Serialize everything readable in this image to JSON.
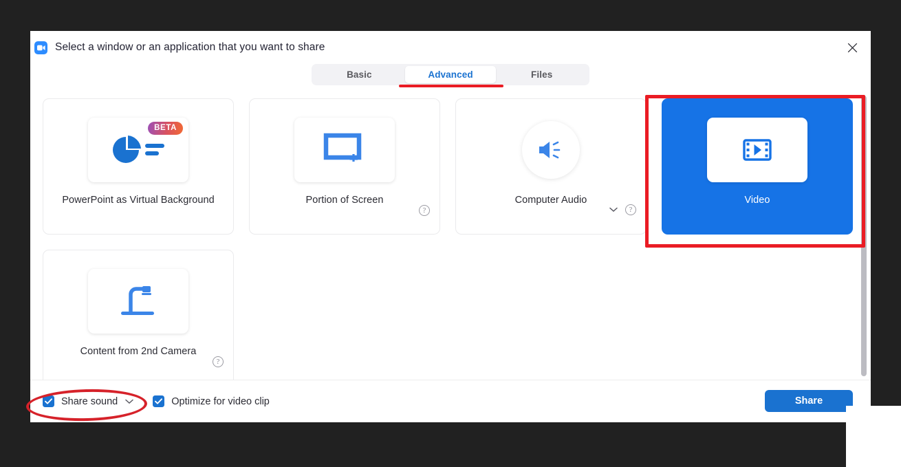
{
  "window": {
    "title": "Select a window or an application that you want to share",
    "logo_icon": "zoom-video-logo-icon",
    "close_icon": "close-icon"
  },
  "tabs": {
    "items": [
      {
        "label": "Basic",
        "active": false
      },
      {
        "label": "Advanced",
        "active": true
      },
      {
        "label": "Files",
        "active": false
      }
    ],
    "active_label": "Advanced"
  },
  "share_options": [
    {
      "label": "PowerPoint as Virtual Background",
      "icon": "pie-chart-slide-icon",
      "badge": "BETA",
      "selected": false,
      "has_help": false,
      "has_chevron": false
    },
    {
      "label": "Portion of Screen",
      "icon": "screen-region-select-icon",
      "selected": false,
      "has_help": true,
      "has_chevron": false
    },
    {
      "label": "Computer Audio",
      "icon": "speaker-audio-icon",
      "selected": false,
      "has_help": true,
      "has_chevron": true
    },
    {
      "label": "Video",
      "icon": "film-play-icon",
      "selected": true,
      "has_help": false,
      "has_chevron": false
    },
    {
      "label": "Content from 2nd Camera",
      "icon": "document-camera-icon",
      "selected": false,
      "has_help": true,
      "has_chevron": false
    }
  ],
  "footer": {
    "share_sound": {
      "label": "Share sound",
      "checked": true,
      "has_chevron": true
    },
    "optimize_video": {
      "label": "Optimize for video clip",
      "checked": true,
      "has_chevron": false
    },
    "share_button": "Share"
  },
  "annotations": {
    "tab_underline": {
      "target": "Advanced",
      "color": "#ea1c24",
      "shape": "underline"
    },
    "video_box": {
      "target": "Video",
      "color": "#ea1c24",
      "shape": "rectangle"
    },
    "share_sound_ellipse": {
      "target": "Share sound",
      "color": "#d6222a",
      "shape": "ellipse"
    }
  },
  "colors": {
    "accent_blue": "#1a72d0",
    "selected_card_blue": "#1673e6",
    "icon_blue": "#3b85e8",
    "annotation_red": "#ea1c24",
    "desktop_background": "#212121"
  }
}
